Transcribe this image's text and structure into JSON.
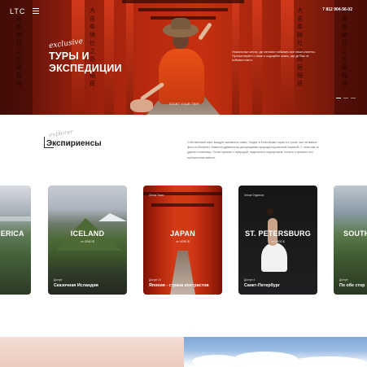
{
  "header": {
    "logo": "LTC",
    "phone": "7 812 904-56-02"
  },
  "hero": {
    "script": "exclusive",
    "title_line1": "ТУРЫ И",
    "title_line2": "ЭКСПЕДИЦИИ",
    "description": "Уникальные места, где мечтают побывать все наши клиенты. Путешествуйте с нами и ощущайте жизнь, где до Вас не побывал никто.",
    "cta": "START YOUR TRIP",
    "glyphs": "大吉奉納社之鳥居稲荷"
  },
  "experiences": {
    "script": "explorer",
    "title": "Экспириенсы",
    "description": "Собственный опыт каждую запомнить нами. Уходят в Енисейских горах по тропе, как на живых фото в Интернет. Кажется удивитеслы декорациями природа под вечной тишиной. С этим как-то удачно и связаны. Почти лучшие с природой, поделиться ощущением, понять и прожить это путешествие вместе."
  },
  "cards": [
    {
      "city": "AMERICA",
      "price": "",
      "tag": "",
      "meta": "",
      "name": ""
    },
    {
      "city": "ICELAND",
      "price": "от 2060 $",
      "tag": "",
      "meta": "Доступ",
      "name": "Сказочная Исландия"
    },
    {
      "city": "JAPAN",
      "price": "от 4030 $",
      "tag": "Летом Токио",
      "meta": "Доступ  14",
      "name": "Япония - страна контрастов"
    },
    {
      "city": "ST. PETERSBURG",
      "price": "от 1800 $",
      "tag": "Летом Отдельно",
      "meta": "Доступ  4",
      "name": "Санкт-Петербург"
    },
    {
      "city": "SOUTH",
      "price": "",
      "tag": "",
      "meta": "Доступ",
      "name": "По обе стор"
    }
  ]
}
